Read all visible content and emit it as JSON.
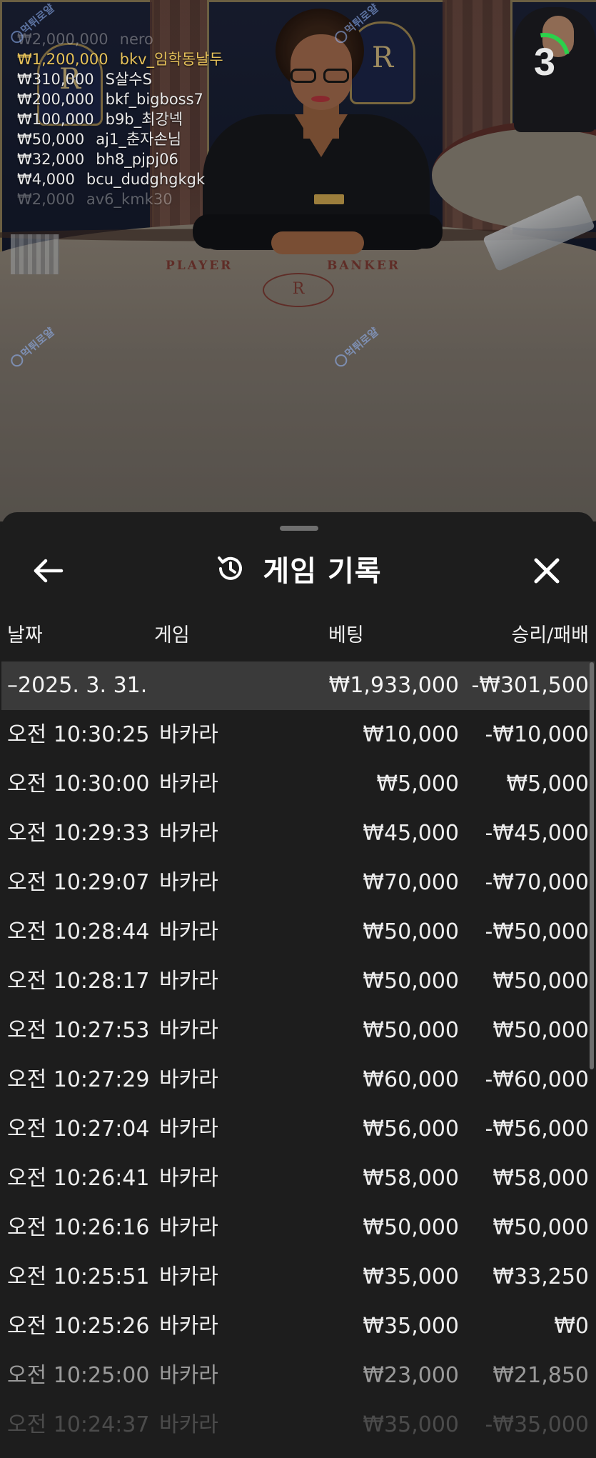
{
  "winners": [
    {
      "amount": "₩2,000,000",
      "user": "nero",
      "style": "fade"
    },
    {
      "amount": "₩1,200,000",
      "user": "bkv_임학동날두",
      "style": "gold"
    },
    {
      "amount": "₩310,000",
      "user": "S살수S",
      "style": "normal"
    },
    {
      "amount": "₩200,000",
      "user": "bkf_bigboss7",
      "style": "normal"
    },
    {
      "amount": "₩100,000",
      "user": "b9b_최강넥",
      "style": "normal"
    },
    {
      "amount": "₩50,000",
      "user": "aj1_춘자손님",
      "style": "normal"
    },
    {
      "amount": "₩32,000",
      "user": "bh8_pjpj06",
      "style": "normal"
    },
    {
      "amount": "₩4,000",
      "user": "bcu_dudghgkgk",
      "style": "normal"
    },
    {
      "amount": "₩2,000",
      "user": "av6_kmk30",
      "style": "fade"
    }
  ],
  "countdown": "3",
  "table": {
    "player_label": "PLAYER",
    "banker_label": "BANKER",
    "crest_letter": "R",
    "logo_letter": "R"
  },
  "watermark": "먹튀로얄",
  "sheet": {
    "title": "게임 기록",
    "icons": {
      "back": "arrow-left-icon",
      "history": "history-icon",
      "close": "close-icon"
    },
    "columns": {
      "date": "날짜",
      "game": "게임",
      "bet": "베팅",
      "result": "승리/패배"
    },
    "summary": {
      "date": "2025. 3. 31.",
      "bet": "₩1,933,000",
      "result": "-₩301,500"
    },
    "rows": [
      {
        "time": "오전 10:30:25",
        "game": "바카라",
        "bet": "₩10,000",
        "result": "-₩10,000"
      },
      {
        "time": "오전 10:30:00",
        "game": "바카라",
        "bet": "₩5,000",
        "result": "₩5,000"
      },
      {
        "time": "오전 10:29:33",
        "game": "바카라",
        "bet": "₩45,000",
        "result": "-₩45,000"
      },
      {
        "time": "오전 10:29:07",
        "game": "바카라",
        "bet": "₩70,000",
        "result": "-₩70,000"
      },
      {
        "time": "오전 10:28:44",
        "game": "바카라",
        "bet": "₩50,000",
        "result": "-₩50,000"
      },
      {
        "time": "오전 10:28:17",
        "game": "바카라",
        "bet": "₩50,000",
        "result": "₩50,000"
      },
      {
        "time": "오전 10:27:53",
        "game": "바카라",
        "bet": "₩50,000",
        "result": "₩50,000"
      },
      {
        "time": "오전 10:27:29",
        "game": "바카라",
        "bet": "₩60,000",
        "result": "-₩60,000"
      },
      {
        "time": "오전 10:27:04",
        "game": "바카라",
        "bet": "₩56,000",
        "result": "-₩56,000"
      },
      {
        "time": "오전 10:26:41",
        "game": "바카라",
        "bet": "₩58,000",
        "result": "₩58,000"
      },
      {
        "time": "오전 10:26:16",
        "game": "바카라",
        "bet": "₩50,000",
        "result": "₩50,000"
      },
      {
        "time": "오전 10:25:51",
        "game": "바카라",
        "bet": "₩35,000",
        "result": "₩33,250"
      },
      {
        "time": "오전 10:25:26",
        "game": "바카라",
        "bet": "₩35,000",
        "result": "₩0"
      },
      {
        "time": "오전 10:25:00",
        "game": "바카라",
        "bet": "₩23,000",
        "result": "₩21,850"
      },
      {
        "time": "오전 10:24:37",
        "game": "바카라",
        "bet": "₩35,000",
        "result": "-₩35,000"
      }
    ]
  }
}
